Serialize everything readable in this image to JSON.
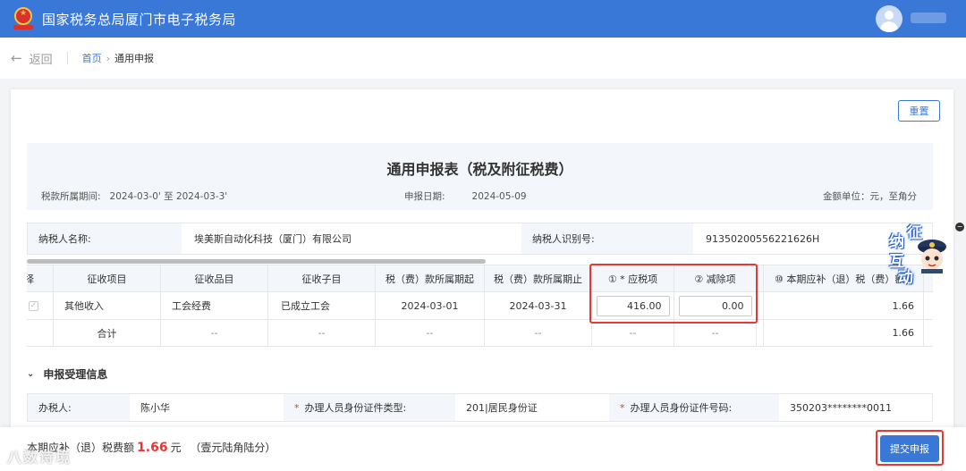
{
  "app": {
    "title": "国家税务总局厦门市电子税务局"
  },
  "nav": {
    "back_label": "返回",
    "breadcrumb": [
      "首页",
      "通用申报"
    ],
    "crumb_sep": "›"
  },
  "actions": {
    "reset_label": "重置",
    "submit_label": "提交申报"
  },
  "form": {
    "title": "通用申报表（税及附征税费）",
    "period_label": "税款所属期间:",
    "period_value": "2024-03-0' 至 2024-03-3'",
    "declare_date_label": "申报日期:",
    "declare_date_value": "2024-05-09",
    "unit_text": "金额单位：元，至角分"
  },
  "taxpayer": {
    "name_label": "纳税人名称:",
    "name_value": "埃美斯自动化科技（厦门）有限公司",
    "id_label": "纳税人识别号:",
    "id_value": "91350200556221626H"
  },
  "table": {
    "headers": [
      "选择",
      "征收项目",
      "征收品目",
      "征收子目",
      "税（费）款所属期起",
      "税（费）款所属期止",
      "① * 应税项",
      "② 减除项",
      "⑩ 本期应补（退）税（费）额"
    ],
    "row1": {
      "checked": "✓",
      "item": "其他收入",
      "category": "工会经费",
      "subitem": "已成立工会",
      "start": "2024-03-01",
      "end": "2024-03-31",
      "taxable": "416.00",
      "deduction": "0.00",
      "amount": "1.66"
    },
    "total": {
      "label": "合计",
      "dash": "--",
      "amount": "1.66"
    }
  },
  "section": {
    "title": "申报受理信息",
    "chevron": "⌄"
  },
  "agent": {
    "handler_label": "办税人:",
    "handler_value": "陈小华",
    "id_type_label": "办理人员身份证件类型:",
    "id_type_value": "201|居民身份证",
    "id_no_label": "办理人员身份证件号码:",
    "id_no_value": "350203********0011"
  },
  "footer": {
    "prefix": "本期应补（退）税费额",
    "amount": "1.66",
    "unit": "元",
    "words": "（壹元陆角陆分）",
    "watermark": "八数诗境"
  },
  "mascot": {
    "chars": [
      "征",
      "纳",
      "互",
      "动"
    ]
  }
}
